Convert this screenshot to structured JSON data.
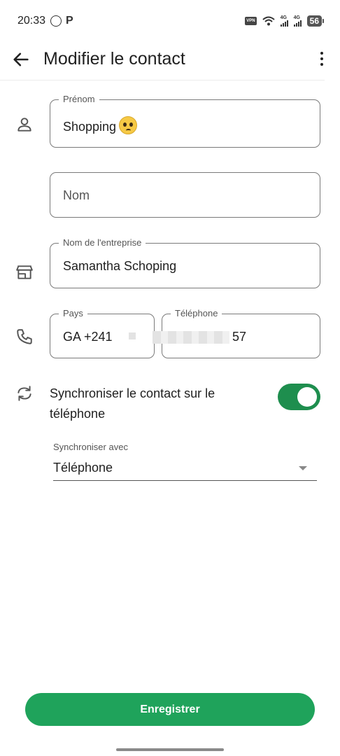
{
  "status_bar": {
    "time": "20:33",
    "vpn": "VPN",
    "sim1_tech": "4G",
    "sim2_tech": "4G",
    "battery": "56"
  },
  "app_bar": {
    "title": "Modifier le contact",
    "back_icon": "arrow-left-icon",
    "more_icon": "more-vert-icon"
  },
  "form": {
    "first_name": {
      "label": "Prénom",
      "value": "Shopping"
    },
    "last_name": {
      "placeholder": "Nom"
    },
    "company": {
      "label": "Nom de l'entreprise",
      "value": "Samantha Schoping"
    },
    "country": {
      "label": "Pays",
      "value": "GA +241"
    },
    "phone": {
      "label": "Téléphone",
      "value_suffix": "57"
    }
  },
  "sync": {
    "label": "Synchroniser le contact sur le téléphone",
    "enabled": true,
    "sync_with_label": "Synchroniser avec",
    "sync_with_value": "Téléphone"
  },
  "actions": {
    "save_label": "Enregistrer"
  },
  "colors": {
    "accent": "#1fa35b",
    "toggle_on": "#1e8e4e"
  }
}
